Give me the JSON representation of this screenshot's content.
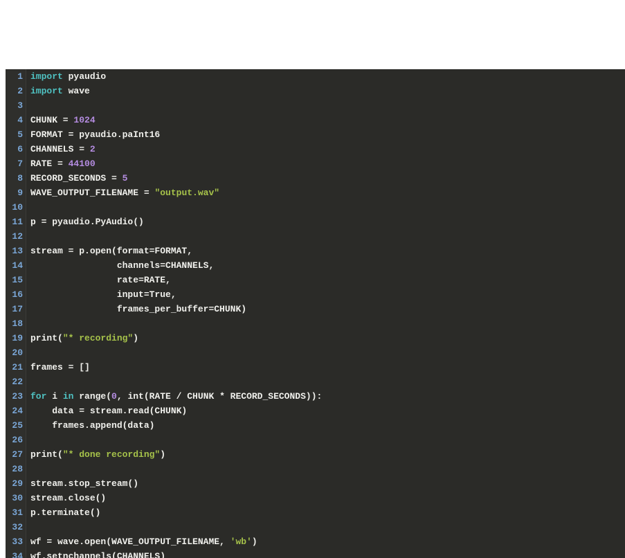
{
  "editor": {
    "lines": [
      {
        "num": 1,
        "tokens": [
          {
            "cls": "keyword",
            "t": "import"
          },
          {
            "cls": "default",
            "t": " pyaudio"
          }
        ]
      },
      {
        "num": 2,
        "tokens": [
          {
            "cls": "keyword",
            "t": "import"
          },
          {
            "cls": "default",
            "t": " wave"
          }
        ]
      },
      {
        "num": 3,
        "tokens": [
          {
            "cls": "default",
            "t": ""
          }
        ]
      },
      {
        "num": 4,
        "tokens": [
          {
            "cls": "default",
            "t": "CHUNK = "
          },
          {
            "cls": "number",
            "t": "1024"
          }
        ]
      },
      {
        "num": 5,
        "tokens": [
          {
            "cls": "default",
            "t": "FORMAT = pyaudio.paInt16"
          }
        ]
      },
      {
        "num": 6,
        "tokens": [
          {
            "cls": "default",
            "t": "CHANNELS = "
          },
          {
            "cls": "number",
            "t": "2"
          }
        ]
      },
      {
        "num": 7,
        "tokens": [
          {
            "cls": "default",
            "t": "RATE = "
          },
          {
            "cls": "number",
            "t": "44100"
          }
        ]
      },
      {
        "num": 8,
        "tokens": [
          {
            "cls": "default",
            "t": "RECORD_SECONDS = "
          },
          {
            "cls": "number",
            "t": "5"
          }
        ]
      },
      {
        "num": 9,
        "tokens": [
          {
            "cls": "default",
            "t": "WAVE_OUTPUT_FILENAME = "
          },
          {
            "cls": "string",
            "t": "\"output.wav\""
          }
        ]
      },
      {
        "num": 10,
        "tokens": [
          {
            "cls": "default",
            "t": ""
          }
        ]
      },
      {
        "num": 11,
        "tokens": [
          {
            "cls": "default",
            "t": "p = pyaudio.PyAudio()"
          }
        ]
      },
      {
        "num": 12,
        "tokens": [
          {
            "cls": "default",
            "t": ""
          }
        ]
      },
      {
        "num": 13,
        "tokens": [
          {
            "cls": "default",
            "t": "stream = p.open(format=FORMAT,"
          }
        ]
      },
      {
        "num": 14,
        "tokens": [
          {
            "cls": "default",
            "t": "                channels=CHANNELS,"
          }
        ]
      },
      {
        "num": 15,
        "tokens": [
          {
            "cls": "default",
            "t": "                rate=RATE,"
          }
        ]
      },
      {
        "num": 16,
        "tokens": [
          {
            "cls": "default",
            "t": "                input=True,"
          }
        ]
      },
      {
        "num": 17,
        "tokens": [
          {
            "cls": "default",
            "t": "                frames_per_buffer=CHUNK)"
          }
        ]
      },
      {
        "num": 18,
        "tokens": [
          {
            "cls": "default",
            "t": ""
          }
        ]
      },
      {
        "num": 19,
        "tokens": [
          {
            "cls": "default",
            "t": "print("
          },
          {
            "cls": "string",
            "t": "\"* recording\""
          },
          {
            "cls": "default",
            "t": ")"
          }
        ]
      },
      {
        "num": 20,
        "tokens": [
          {
            "cls": "default",
            "t": ""
          }
        ]
      },
      {
        "num": 21,
        "tokens": [
          {
            "cls": "default",
            "t": "frames = []"
          }
        ]
      },
      {
        "num": 22,
        "tokens": [
          {
            "cls": "default",
            "t": ""
          }
        ]
      },
      {
        "num": 23,
        "tokens": [
          {
            "cls": "keyword",
            "t": "for"
          },
          {
            "cls": "default",
            "t": " i "
          },
          {
            "cls": "keyword",
            "t": "in"
          },
          {
            "cls": "default",
            "t": " range("
          },
          {
            "cls": "number",
            "t": "0"
          },
          {
            "cls": "default",
            "t": ", int(RATE / CHUNK * RECORD_SECONDS)):"
          }
        ]
      },
      {
        "num": 24,
        "tokens": [
          {
            "cls": "default",
            "t": "    data = stream.read(CHUNK)"
          }
        ]
      },
      {
        "num": 25,
        "tokens": [
          {
            "cls": "default",
            "t": "    frames.append(data)"
          }
        ]
      },
      {
        "num": 26,
        "tokens": [
          {
            "cls": "default",
            "t": ""
          }
        ]
      },
      {
        "num": 27,
        "tokens": [
          {
            "cls": "default",
            "t": "print("
          },
          {
            "cls": "string",
            "t": "\"* done recording\""
          },
          {
            "cls": "default",
            "t": ")"
          }
        ]
      },
      {
        "num": 28,
        "tokens": [
          {
            "cls": "default",
            "t": ""
          }
        ]
      },
      {
        "num": 29,
        "tokens": [
          {
            "cls": "default",
            "t": "stream.stop_stream()"
          }
        ]
      },
      {
        "num": 30,
        "tokens": [
          {
            "cls": "default",
            "t": "stream.close()"
          }
        ]
      },
      {
        "num": 31,
        "tokens": [
          {
            "cls": "default",
            "t": "p.terminate()"
          }
        ]
      },
      {
        "num": 32,
        "tokens": [
          {
            "cls": "default",
            "t": ""
          }
        ]
      },
      {
        "num": 33,
        "tokens": [
          {
            "cls": "default",
            "t": "wf = wave.open(WAVE_OUTPUT_FILENAME, "
          },
          {
            "cls": "string",
            "t": "'wb'"
          },
          {
            "cls": "default",
            "t": ")"
          }
        ]
      },
      {
        "num": 34,
        "tokens": [
          {
            "cls": "default",
            "t": "wf.setnchannels(CHANNELS)"
          }
        ]
      }
    ]
  }
}
